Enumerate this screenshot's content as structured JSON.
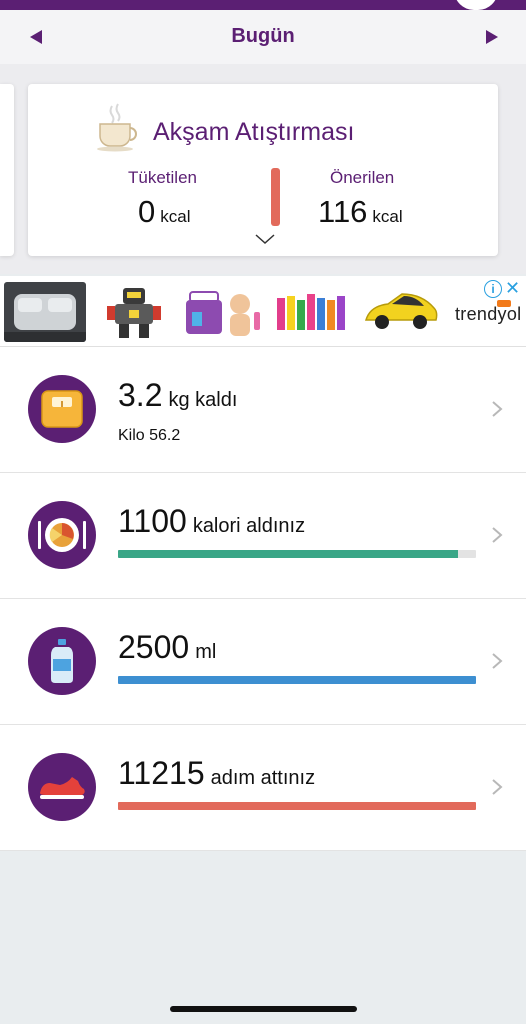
{
  "header": {
    "date_title": "Bugün"
  },
  "meal_card": {
    "title": "Akşam Atıştırması",
    "consumed_label": "Tüketilen",
    "consumed_value": "0",
    "consumed_unit": "kcal",
    "recommended_label": "Önerilen",
    "recommended_value": "116",
    "recommended_unit": "kcal",
    "icon": "coffee-cup-icon"
  },
  "ad": {
    "brand": "trendyol",
    "thumbnails": [
      "car-air-mattress-ad",
      "robot-toy-ad",
      "baby-doll-set-ad",
      "paint-bottles-ad",
      "toy-sports-car-ad"
    ],
    "info_symbol": "i",
    "close_symbol": "✕"
  },
  "rows": {
    "weight": {
      "value": "3.2",
      "text": "kg kaldı",
      "sub": "Kilo 56.2",
      "icon": "scale-icon"
    },
    "calories": {
      "value": "1100",
      "text": "kalori aldınız",
      "progress": 0.95,
      "color": "#3aa687",
      "icon": "plate-icon"
    },
    "water": {
      "value": "2500",
      "text": "ml",
      "progress": 1.0,
      "color": "#3d8fd1",
      "icon": "water-bottle-icon"
    },
    "steps": {
      "value": "11215",
      "text": "adım attınız",
      "progress": 1.0,
      "color": "#e26a5b",
      "icon": "sneaker-icon"
    }
  },
  "colors": {
    "brand_purple": "#5b1f73",
    "divider_red": "#e26a5b"
  }
}
